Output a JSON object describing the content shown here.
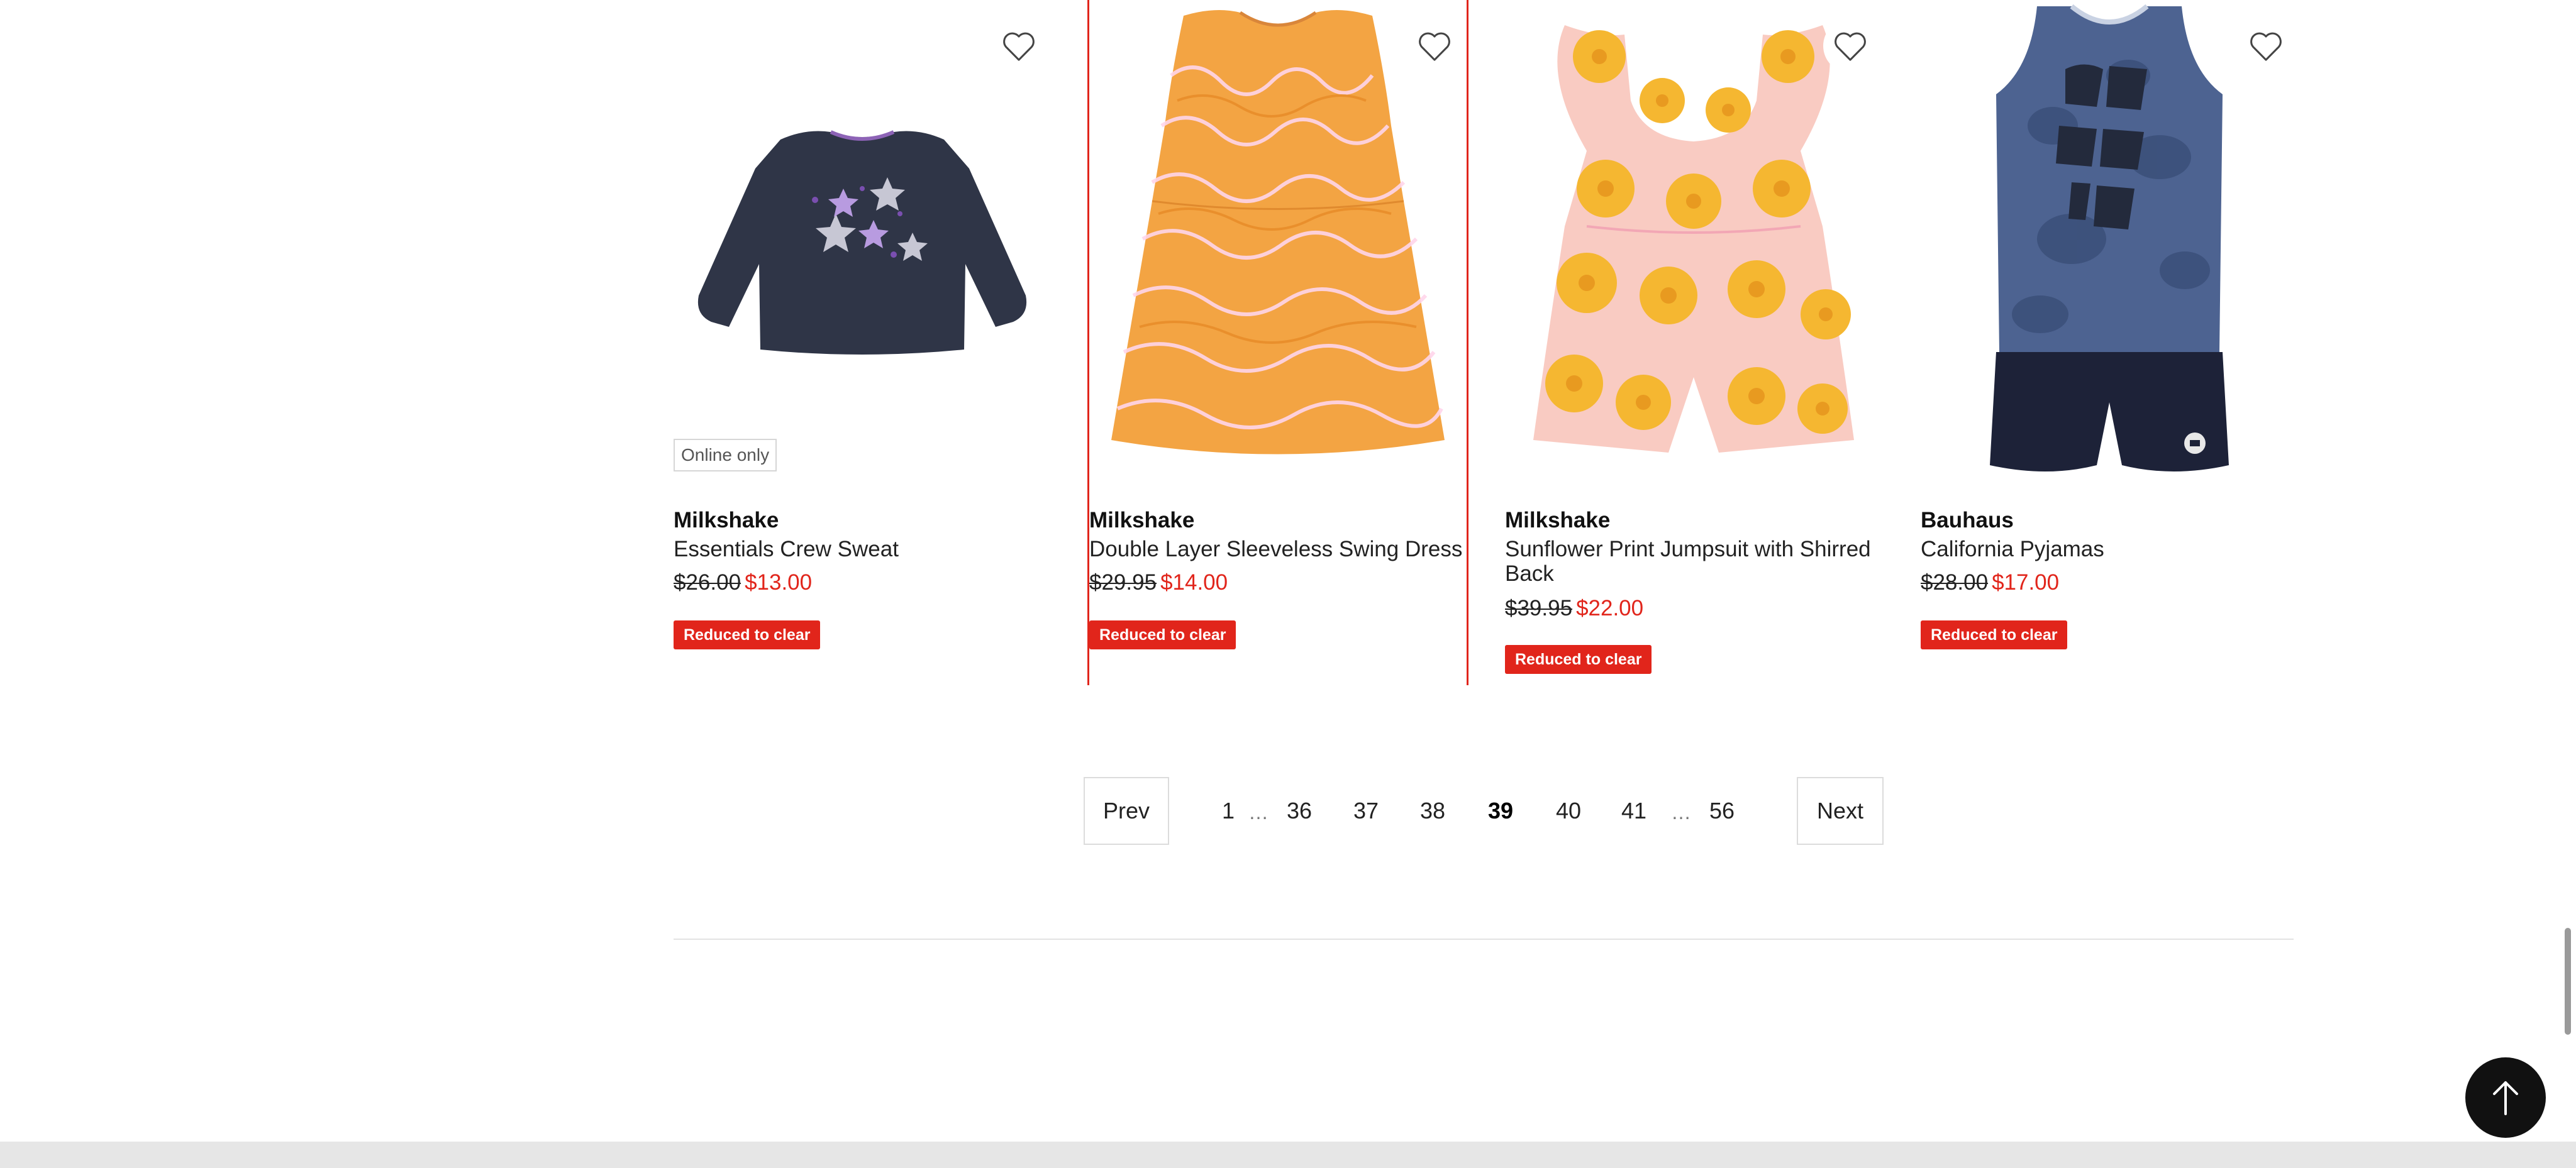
{
  "products": [
    {
      "brand": "Milkshake",
      "name": "Essentials Crew Sweat",
      "was_price": "$26.00",
      "now_price": "$13.00",
      "tag": "Reduced to clear",
      "badge": "Online only",
      "image": "navy crew sweat with glitter stars"
    },
    {
      "brand": "Milkshake",
      "name": "Double Layer Sleeveless Swing Dress",
      "was_price": "$29.95",
      "now_price": "$14.00",
      "tag": "Reduced to clear",
      "image": "orange zebra print sleeveless dress"
    },
    {
      "brand": "Milkshake",
      "name": "Sunflower Print Jumpsuit with Shirred Back",
      "was_price": "$39.95",
      "now_price": "$22.00",
      "tag": "Reduced to clear",
      "image": "pink and yellow sunflower frill jumpsuit"
    },
    {
      "brand": "Bauhaus",
      "name": "California Pyjamas",
      "was_price": "$28.00",
      "now_price": "$17.00",
      "tag": "Reduced to clear",
      "image": "tie-dye blue tank top with navy shorts"
    }
  ],
  "pagination": {
    "prev": "Prev",
    "next": "Next",
    "first": "1",
    "ellipsis": "…",
    "pages": [
      "36",
      "37",
      "38",
      "39",
      "40",
      "41"
    ],
    "current": "39",
    "last": "56"
  },
  "icons": {
    "wishlist": "heart-icon",
    "back_to_top": "arrow-up-icon"
  },
  "colors": {
    "sale_red": "#e1251b",
    "text": "#222222"
  }
}
